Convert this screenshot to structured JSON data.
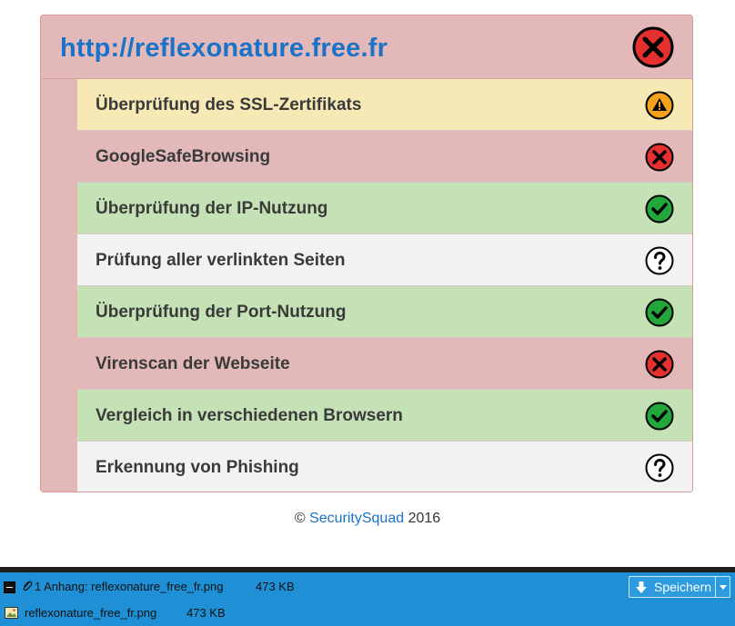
{
  "site": {
    "url": "http://reflexonature.free.fr",
    "overall_status": "fail"
  },
  "checks": [
    {
      "label": "Überprüfung des SSL-Zertifikats",
      "status": "warn"
    },
    {
      "label": "GoogleSafeBrowsing",
      "status": "fail"
    },
    {
      "label": "Überprüfung der IP-Nutzung",
      "status": "ok"
    },
    {
      "label": "Prüfung aller verlinkten Seiten",
      "status": "unknown"
    },
    {
      "label": "Überprüfung der Port-Nutzung",
      "status": "ok"
    },
    {
      "label": "Virenscan der Webseite",
      "status": "fail"
    },
    {
      "label": "Vergleich in verschiedenen Browsern",
      "status": "ok"
    },
    {
      "label": "Erkennung von Phishing",
      "status": "unknown"
    }
  ],
  "footer": {
    "copyright": "©",
    "brand": "SecuritySquad",
    "year": "2016"
  },
  "attachments": {
    "header": "1 Anhang: reflexonature_free_fr.png",
    "header_size": "473 KB",
    "file_name": "reflexonature_free_fr.png",
    "file_size": "473 KB",
    "save_label": "Speichern"
  },
  "colors": {
    "fail": "#e2b8b8",
    "warn": "#f6e9b5",
    "ok": "#c5e2b7",
    "unknown": "#f2f2f2",
    "link": "#1a73c9",
    "attach_bar": "#1f8fd6"
  }
}
